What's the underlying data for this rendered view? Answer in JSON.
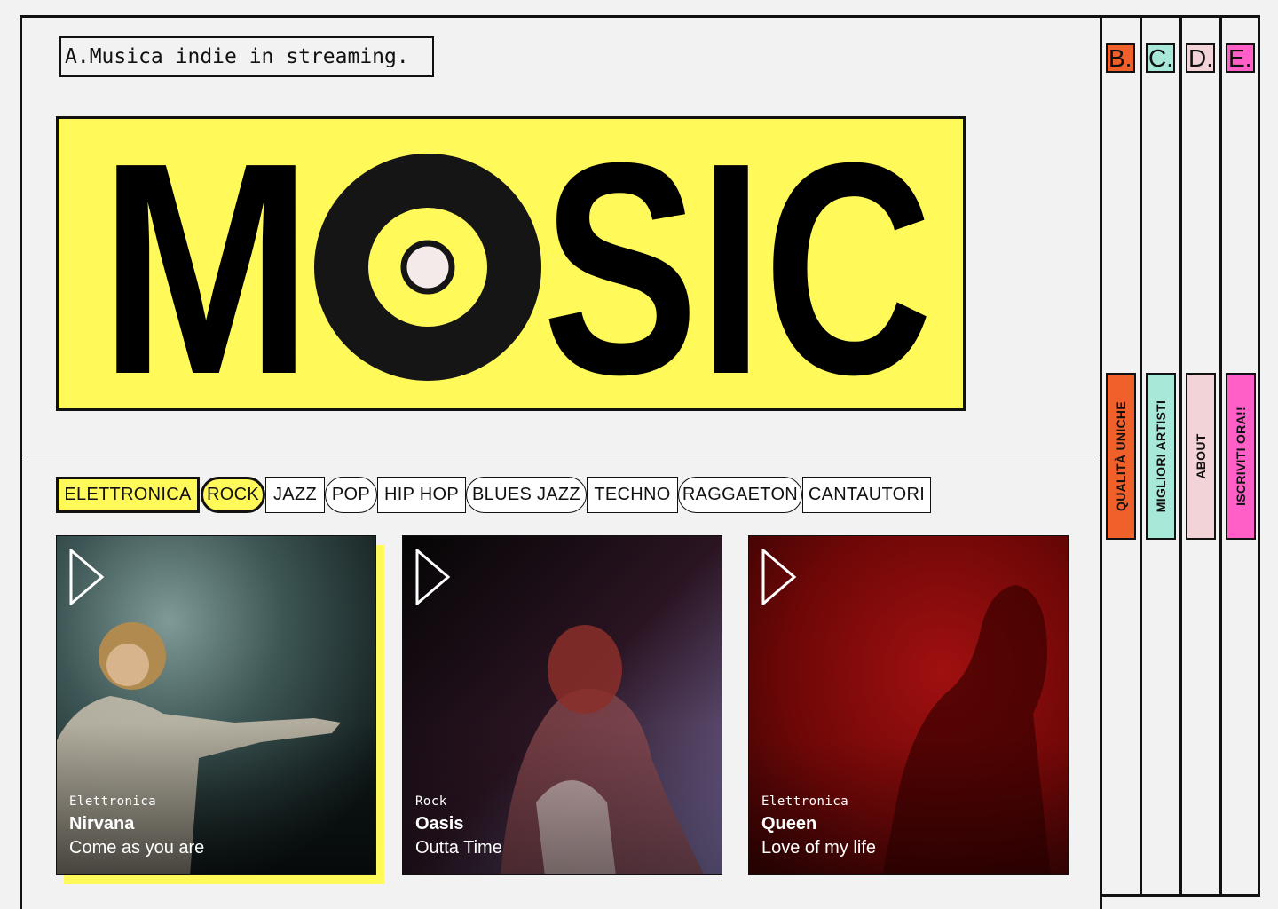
{
  "header": {
    "tagline": "A.Musica indie in streaming."
  },
  "logo": {
    "m": "M",
    "o": "O",
    "sic": "SIC",
    "colors": {
      "bg": "#fff95a",
      "ink": "#000000",
      "vinyl": "#151515",
      "center": "#f4eaea"
    }
  },
  "genres": [
    {
      "label": "ELETTRONICA",
      "active": true
    },
    {
      "label": "ROCK",
      "active": true
    },
    {
      "label": "JAZZ",
      "active": false
    },
    {
      "label": "POP",
      "active": false
    },
    {
      "label": "HIP HOP",
      "active": false
    },
    {
      "label": "BLUES JAZZ",
      "active": false
    },
    {
      "label": "TECHNO",
      "active": false
    },
    {
      "label": "RAGGAETON",
      "active": false
    },
    {
      "label": "CANTAUTORI",
      "active": false
    }
  ],
  "cards": [
    {
      "genre": "Elettronica",
      "artist": "Nirvana",
      "song": "Come as you are",
      "icon": "play-icon"
    },
    {
      "genre": "Rock",
      "artist": "Oasis",
      "song": "Outta Time",
      "icon": "play-icon"
    },
    {
      "genre": "Elettronica",
      "artist": "Queen",
      "song": "Love of my life",
      "icon": "play-icon"
    }
  ],
  "sidebar": [
    {
      "letter": "B.",
      "label": "QUALITÀ UNICHE",
      "color": "#f0602a"
    },
    {
      "letter": "C.",
      "label": "MIGLIORI ARTISTI",
      "color": "#a8e8d8"
    },
    {
      "letter": "D.",
      "label": "ABOUT",
      "color": "#f2d4d8"
    },
    {
      "letter": "E.",
      "label": "ISCRIVITI ORA!!",
      "color": "#ff5fc6"
    }
  ],
  "colors": {
    "accent": "#fff95a",
    "ink": "#111111",
    "background": "#f2f2f2"
  }
}
